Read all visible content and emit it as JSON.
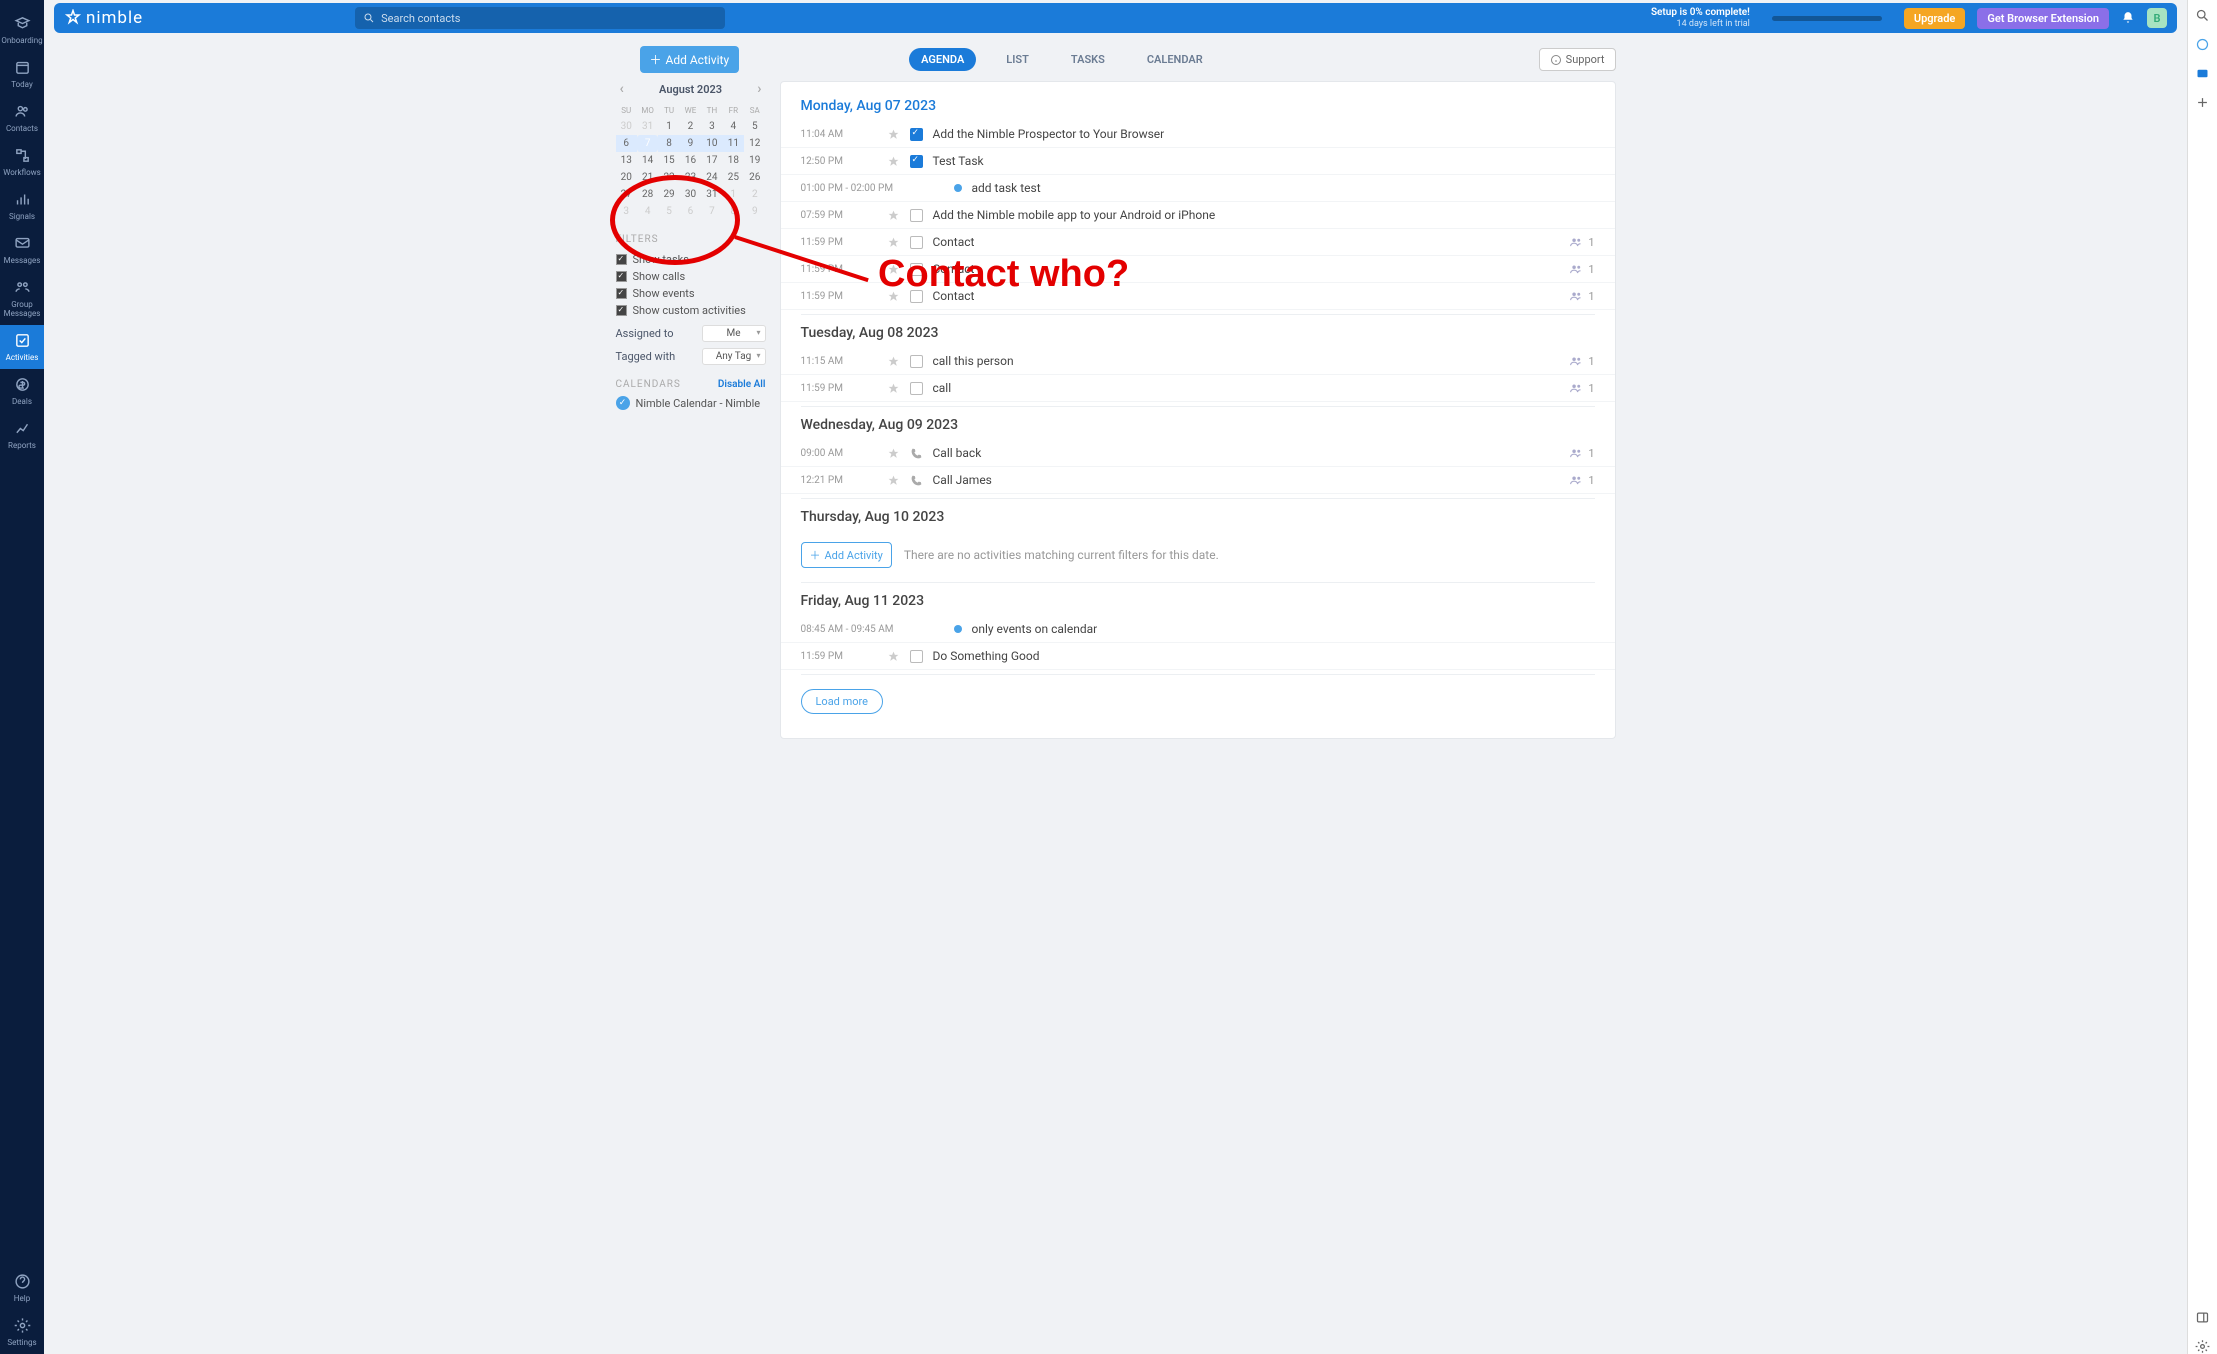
{
  "brand": "nimble",
  "search_placeholder": "Search contacts",
  "setup": {
    "title": "Setup is 0% complete!",
    "sub": "14 days left in trial"
  },
  "btn_upgrade": "Upgrade",
  "btn_ext": "Get Browser Extension",
  "avatar_initial": "B",
  "nav": [
    {
      "label": "Onboarding",
      "icon": "grad"
    },
    {
      "label": "Today",
      "icon": "cal"
    },
    {
      "label": "Contacts",
      "icon": "people"
    },
    {
      "label": "Workflows",
      "icon": "flow"
    },
    {
      "label": "Signals",
      "icon": "signal"
    },
    {
      "label": "Messages",
      "icon": "msg"
    },
    {
      "label": "Group Messages",
      "icon": "group"
    },
    {
      "label": "Activities",
      "icon": "check",
      "active": true
    },
    {
      "label": "Deals",
      "icon": "deal"
    },
    {
      "label": "Reports",
      "icon": "report"
    }
  ],
  "nav_bottom": [
    {
      "label": "Help",
      "icon": "help"
    },
    {
      "label": "Settings",
      "icon": "gear"
    }
  ],
  "add_activity": "Add Activity",
  "tabs": [
    {
      "label": "AGENDA",
      "active": true
    },
    {
      "label": "LIST"
    },
    {
      "label": "TASKS"
    },
    {
      "label": "CALENDAR"
    }
  ],
  "support": "Support",
  "calendar": {
    "month": "August 2023",
    "dow": [
      "SU",
      "MO",
      "TU",
      "WE",
      "TH",
      "FR",
      "SA"
    ],
    "weeks": [
      [
        {
          "n": 30,
          "dim": true
        },
        {
          "n": 31,
          "dim": true
        },
        {
          "n": 1
        },
        {
          "n": 2
        },
        {
          "n": 3
        },
        {
          "n": 4
        },
        {
          "n": 5
        }
      ],
      [
        {
          "n": 6,
          "range": true
        },
        {
          "n": 7,
          "today": true,
          "range": true
        },
        {
          "n": 8,
          "range": true
        },
        {
          "n": 9,
          "range": true
        },
        {
          "n": 10,
          "range": true
        },
        {
          "n": 11,
          "range": true
        },
        {
          "n": 12
        }
      ],
      [
        {
          "n": 13
        },
        {
          "n": 14
        },
        {
          "n": 15
        },
        {
          "n": 16
        },
        {
          "n": 17
        },
        {
          "n": 18
        },
        {
          "n": 19
        }
      ],
      [
        {
          "n": 20
        },
        {
          "n": 21
        },
        {
          "n": 22
        },
        {
          "n": 23
        },
        {
          "n": 24
        },
        {
          "n": 25
        },
        {
          "n": 26
        }
      ],
      [
        {
          "n": 27
        },
        {
          "n": 28
        },
        {
          "n": 29
        },
        {
          "n": 30
        },
        {
          "n": 31
        },
        {
          "n": 1,
          "dim": true
        },
        {
          "n": 2,
          "dim": true
        }
      ],
      [
        {
          "n": 3,
          "dim": true
        },
        {
          "n": 4,
          "dim": true
        },
        {
          "n": 5,
          "dim": true
        },
        {
          "n": 6,
          "dim": true
        },
        {
          "n": 7,
          "dim": true
        },
        {
          "n": 8,
          "dim": true
        },
        {
          "n": 9,
          "dim": true
        }
      ]
    ]
  },
  "filters_title": "FILTERS",
  "filters": [
    "Show tasks",
    "Show calls",
    "Show events",
    "Show custom activities"
  ],
  "assigned_label": "Assigned to",
  "assigned_value": "Me",
  "tagged_label": "Tagged with",
  "tagged_value": "Any Tag",
  "calendars_title": "CALENDARS",
  "disable_all": "Disable All",
  "calendar_name": "Nimble Calendar - Nimble",
  "days": [
    {
      "title": "Monday, Aug 07 2023",
      "first": true,
      "rows": [
        {
          "time": "11:04 AM",
          "kind": "task",
          "done": true,
          "title": "Add the Nimble Prospector to Your Browser"
        },
        {
          "time": "12:50 PM",
          "kind": "task",
          "done": true,
          "title": "Test Task"
        },
        {
          "time": "01:00 PM - 02:00 PM",
          "wide": true,
          "kind": "event",
          "title": "add task test"
        },
        {
          "time": "07:59 PM",
          "kind": "task",
          "title": "Add the Nimble mobile app to your Android or iPhone"
        },
        {
          "time": "11:59 PM",
          "kind": "task",
          "title": "Contact",
          "count": 1
        },
        {
          "time": "11:59 PM",
          "kind": "task",
          "title": "Contact",
          "count": 1
        },
        {
          "time": "11:59 PM",
          "kind": "task",
          "title": "Contact",
          "count": 1
        }
      ]
    },
    {
      "title": "Tuesday, Aug 08 2023",
      "rows": [
        {
          "time": "11:15 AM",
          "kind": "task",
          "title": "call this person",
          "count": 1
        },
        {
          "time": "11:59 PM",
          "kind": "task",
          "title": "call",
          "count": 1
        }
      ]
    },
    {
      "title": "Wednesday, Aug 09 2023",
      "rows": [
        {
          "time": "09:00 AM",
          "kind": "call",
          "title": "Call back",
          "count": 1
        },
        {
          "time": "12:21 PM",
          "kind": "call",
          "title": "Call James",
          "count": 1
        }
      ]
    },
    {
      "title": "Thursday, Aug 10 2023",
      "empty": true,
      "empty_text": "There are no activities matching current filters for this date."
    },
    {
      "title": "Friday, Aug 11 2023",
      "rows": [
        {
          "time": "08:45 AM - 09:45 AM",
          "wide": true,
          "kind": "event",
          "title": "only events on calendar"
        },
        {
          "time": "11:59 PM",
          "kind": "task",
          "title": "Do Something Good"
        }
      ]
    }
  ],
  "load_more": "Load more",
  "annotation": "Contact who?"
}
